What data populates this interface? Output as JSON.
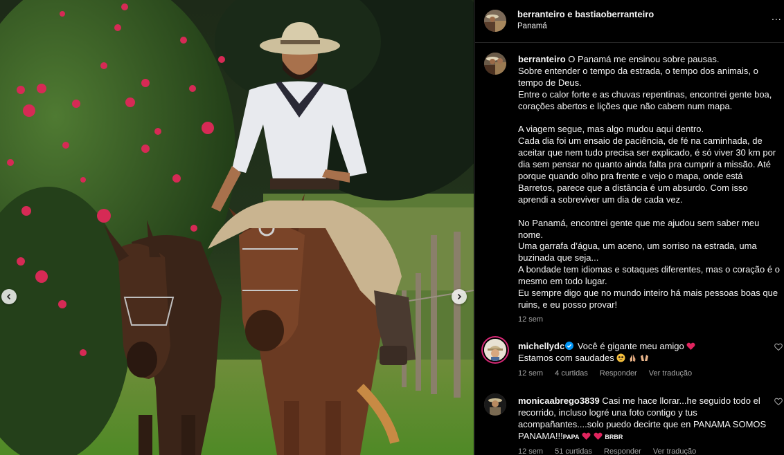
{
  "header": {
    "title": "berranteiro e bastiaoberranteiro",
    "location": "Panamá",
    "more_label": "..."
  },
  "caption": {
    "username": "berranteiro",
    "first_line": "O Panamá me ensinou sobre pausas.",
    "para1": "Sobre entender o tempo da estrada, o tempo dos animais, o tempo de Deus.\nEntre o calor forte e as chuvas repentinas, encontrei gente boa, corações abertos e lições que não cabem num mapa.",
    "para2": "A viagem segue, mas algo mudou aqui dentro.\nCada dia foi um ensaio de paciência, de fé na caminhada, de aceitar que nem tudo precisa ser explicado, é só viver 30 km por dia sem pensar no quanto ainda falta pra cumprir a missão. Até porque quando olho pra frente e vejo o mapa, onde está Barretos, parece que a distância é um absurdo. Com isso aprendi a sobreviver um dia de cada vez.",
    "para3": "No Panamá, encontrei gente que me ajudou sem saber meu nome.\nUma garrafa d’água, um aceno, um sorriso na estrada, uma buzinada que seja...\nA bondade tem idiomas e sotaques diferentes, mas o coração é o mesmo em todo lugar.\nEu sempre digo que no mundo inteiro há mais pessoas boas que ruins, e eu posso provar!",
    "time": "12 sem"
  },
  "comments": [
    {
      "username": "michellydc",
      "verified": true,
      "text_line1": "Você é gigante meu amigo",
      "text_line2": "Estamos com saudades",
      "time": "12 sem",
      "likes": "4 curtidas",
      "reply": "Responder",
      "translate": "Ver tradução"
    },
    {
      "username": "monicaabrego3839",
      "text": "Casi me hace llorar...he seguido todo el recorrido, incluso logré una foto contigo y tus acompañantes....solo puedo decirte que en PANAMA SOMOS PANAMA!!!",
      "tag1": "PAPA",
      "tag2": "BRBR",
      "time": "12 sem",
      "likes": "51 curtidas",
      "reply": "Responder",
      "translate": "Ver tradução"
    }
  ],
  "icons": {
    "nav_prev": "chevron-left-icon",
    "nav_next": "chevron-right-icon",
    "verified": "verified-badge-icon",
    "heart": "heart-icon"
  },
  "colors": {
    "background": "#000000",
    "text": "#f5f5f5",
    "secondary_text": "#a8a8a8",
    "verified": "#0095f6",
    "heart": "#ff3040"
  }
}
